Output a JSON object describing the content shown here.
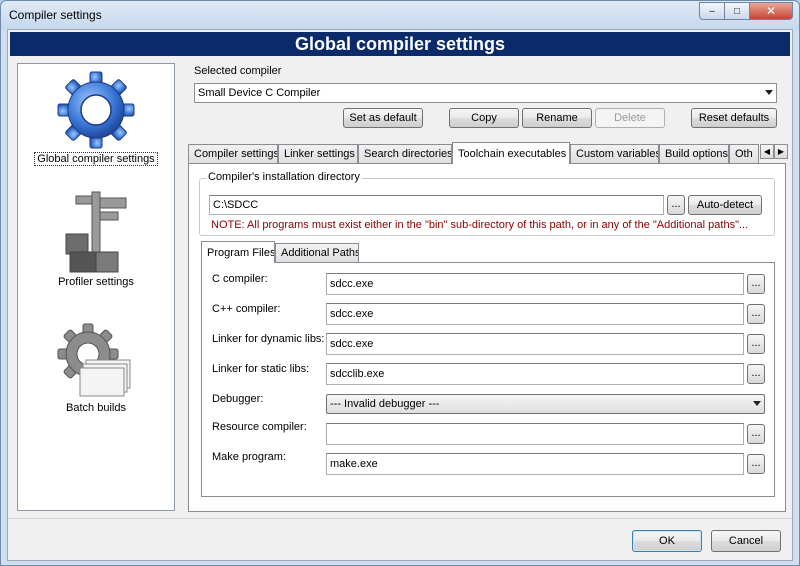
{
  "window": {
    "title": "Compiler settings",
    "controls": {
      "minimize": "–",
      "maximize": "□",
      "close": "✕"
    }
  },
  "header": {
    "title": "Global compiler settings"
  },
  "sidebar": {
    "items": [
      {
        "label": "Global compiler settings",
        "icon": "gear-icon",
        "selected": true
      },
      {
        "label": "Profiler settings",
        "icon": "caliper-blocks-icon",
        "selected": false
      },
      {
        "label": "Batch builds",
        "icon": "gear-papers-icon",
        "selected": false
      }
    ]
  },
  "compiler": {
    "group_label": "Selected compiler",
    "selected": "Small Device C Compiler",
    "buttons": {
      "set_default": "Set as default",
      "copy": "Copy",
      "rename": "Rename",
      "delete": "Delete",
      "reset_defaults": "Reset defaults"
    }
  },
  "tabs": [
    "Compiler settings",
    "Linker settings",
    "Search directories",
    "Toolchain executables",
    "Custom variables",
    "Build options",
    "Oth"
  ],
  "active_tab": "Toolchain executables",
  "install_dir": {
    "group_label": "Compiler's installation directory",
    "value": "C:\\SDCC",
    "browse": "...",
    "auto_detect": "Auto-detect",
    "note": "NOTE: All programs must exist either in the \"bin\" sub-directory of this path, or in any of the \"Additional paths\"..."
  },
  "subtabs": [
    "Program Files",
    "Additional Paths"
  ],
  "programs": {
    "c_compiler": {
      "label": "C compiler:",
      "value": "sdcc.exe"
    },
    "cpp_compiler": {
      "label": "C++ compiler:",
      "value": "sdcc.exe"
    },
    "linker_dynamic": {
      "label": "Linker for dynamic libs:",
      "value": "sdcc.exe"
    },
    "linker_static": {
      "label": "Linker for static libs:",
      "value": "sdcclib.exe"
    },
    "debugger": {
      "label": "Debugger:",
      "value": "--- Invalid debugger ---"
    },
    "resource_compiler": {
      "label": "Resource compiler:",
      "value": ""
    },
    "make_program": {
      "label": "Make program:",
      "value": "make.exe"
    }
  },
  "dialog_buttons": {
    "ok": "OK",
    "cancel": "Cancel"
  },
  "colors": {
    "header_band": "#0a2a6a",
    "note_text": "#8b0000"
  }
}
